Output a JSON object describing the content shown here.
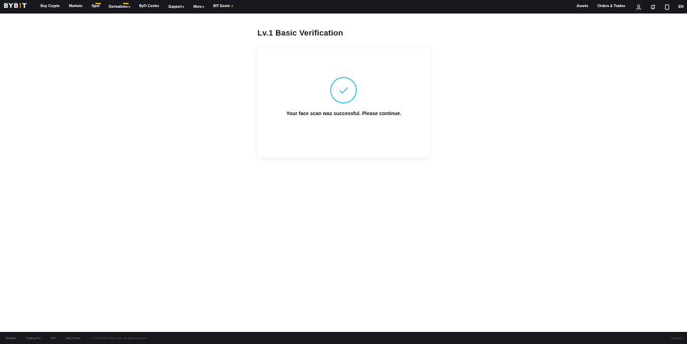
{
  "topnav": {
    "logo": {
      "left": "BYB",
      "accent": "!",
      "right": "T"
    },
    "items": [
      {
        "label": "Buy Crypto"
      },
      {
        "label": "Markets"
      },
      {
        "label": "Spot"
      },
      {
        "label": "Derivatives"
      },
      {
        "label": "ByFi Center"
      },
      {
        "label": "Support"
      },
      {
        "label": "More"
      },
      {
        "label": "BIT Event"
      }
    ],
    "assets_label": "Assets",
    "orders_label": "Orders & Trades",
    "language": "EN",
    "caret": "▾",
    "flame": "●"
  },
  "main": {
    "title": "Lv.1 Basic Verification",
    "success_message": "Your face scan was successful. Please continue."
  },
  "footer": {
    "links": [
      {
        "label": "Markets"
      },
      {
        "label": "Trading Fee"
      },
      {
        "label": "API"
      },
      {
        "label": "Help Center"
      }
    ],
    "copyright": "© 2018-2021 Bybit.com. All rights reserved.",
    "routing": "Routing 1"
  },
  "colors": {
    "nav_bg": "#17181e",
    "brand_accent": "#f7a600",
    "success_teal": "#20b2d6",
    "text_primary": "#121214"
  }
}
